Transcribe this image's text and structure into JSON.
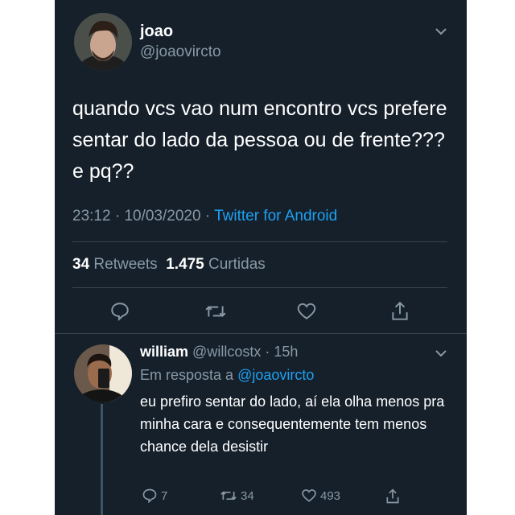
{
  "tweet": {
    "author_name": "joao",
    "author_handle": "@joaovircto",
    "text": "quando vcs vao num encontro vcs prefere sentar do lado da pessoa ou de frente??? e pq??",
    "time": "23:12",
    "separator": "·",
    "date": "10/03/2020",
    "client": "Twitter for Android",
    "retweets_count": "34",
    "retweets_label": "Retweets",
    "likes_count": "1.475",
    "likes_label": "Curtidas"
  },
  "reply": {
    "author_name": "william",
    "author_handle": "@willcostx",
    "separator": "·",
    "time": "15h",
    "replying_to_label": "Em resposta a",
    "replying_to_handle": "@joaovircto",
    "text": "eu prefiro sentar do lado, aí ela olha menos pra minha cara e consequentemente tem menos chance dela desistir",
    "reply_count": "7",
    "retweet_count": "34",
    "like_count": "493"
  },
  "icons": {
    "reply": "reply-icon",
    "retweet": "retweet-icon",
    "like": "heart-icon",
    "share": "share-icon",
    "chevron": "chevron-down-icon"
  },
  "colors": {
    "background": "#15202b",
    "text": "#ffffff",
    "secondary": "#8899a6",
    "accent": "#1da1f2",
    "divider": "#38444d"
  }
}
